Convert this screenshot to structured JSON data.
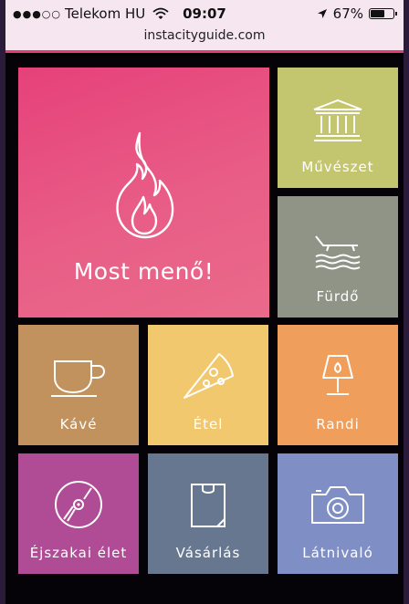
{
  "status_bar": {
    "signal": "●●●○○",
    "carrier": "Telekom HU",
    "time": "09:07",
    "battery_percent": "67%",
    "battery_level": 0.67
  },
  "browser": {
    "url": "instacityguide.com"
  },
  "tiles": {
    "most_meno": {
      "label": "Most menő!",
      "icon": "flame-icon",
      "color": "#e6417a"
    },
    "muveszet": {
      "label": "Művészet",
      "icon": "museum-icon",
      "color": "#c3c56f"
    },
    "furdo": {
      "label": "Fürdő",
      "icon": "sunbed-water-icon",
      "color": "#8f9486"
    },
    "kave": {
      "label": "Kávé",
      "icon": "coffee-cup-icon",
      "color": "#c1925e"
    },
    "etel": {
      "label": "Étel",
      "icon": "pizza-slice-icon",
      "color": "#f2c86f"
    },
    "randi": {
      "label": "Randi",
      "icon": "lamp-icon",
      "color": "#ef9f5b"
    },
    "ejszakai": {
      "label": "Éjszakai élet",
      "icon": "vinyl-record-icon",
      "color": "#b04b96"
    },
    "vasarlas": {
      "label": "Vásárlás",
      "icon": "shopping-bag-icon",
      "color": "#687790"
    },
    "latnivalo": {
      "label": "Látnivaló",
      "icon": "camera-icon",
      "color": "#7f8fc6"
    }
  }
}
